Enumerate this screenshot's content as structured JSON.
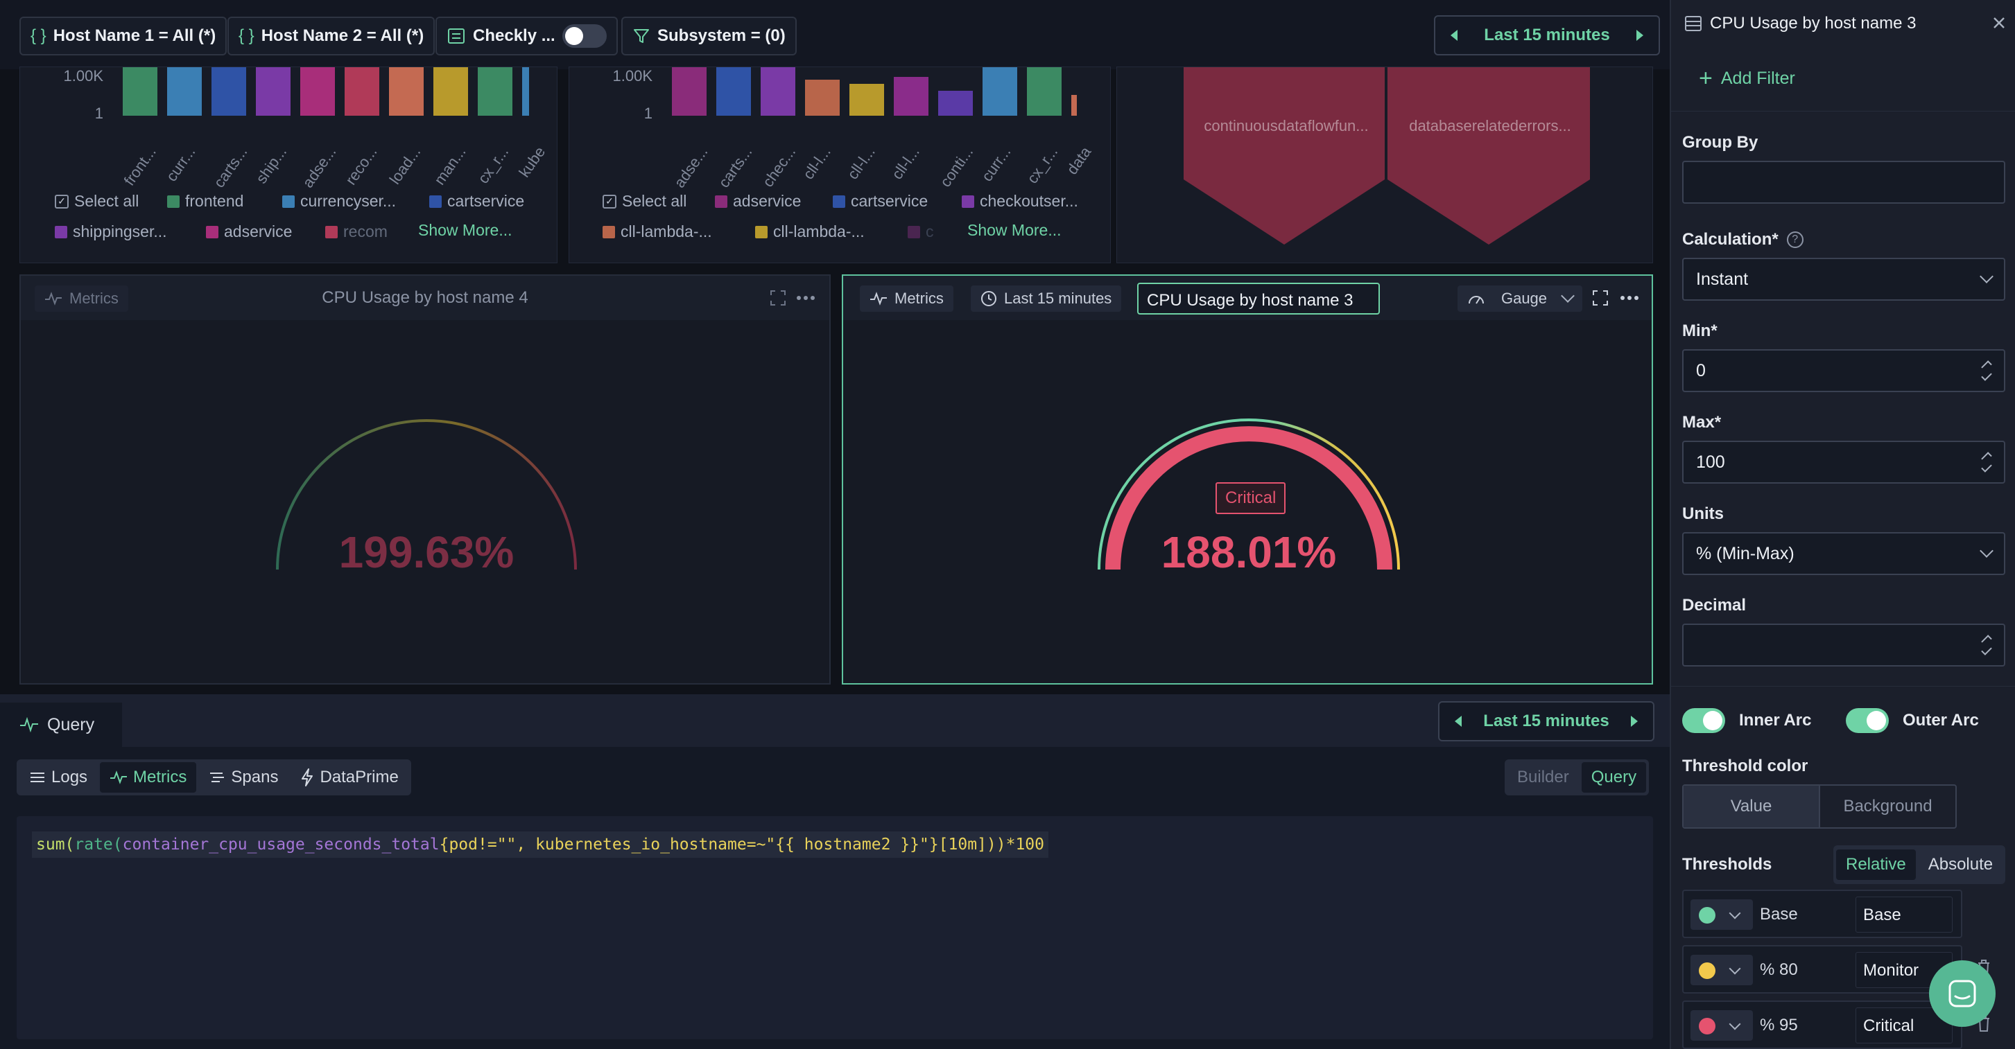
{
  "filters": {
    "host1": "Host Name 1 = All (*)",
    "host2": "Host Name 2 = All (*)",
    "checkly": "Checkly ...",
    "subsystem": "Subsystem = (0)",
    "time": "Last 15 minutes"
  },
  "top_widgets": {
    "left": {
      "yticks": [
        "1.00K",
        "1"
      ],
      "xticks": [
        "front...",
        "curr...",
        "carts...",
        "ship...",
        "adse...",
        "reco...",
        "load...",
        "man...",
        "cx_r...",
        "kube"
      ],
      "legend": [
        "Select all",
        "frontend",
        "currencyser...",
        "cartservice",
        "shippingser...",
        "adservice",
        "recom"
      ],
      "show_more": "Show More..."
    },
    "middle": {
      "yticks": [
        "1.00K",
        "1"
      ],
      "xticks": [
        "adse...",
        "carts...",
        "chec...",
        "cll-l...",
        "cll-l...",
        "cll-l...",
        "conti...",
        "curr...",
        "cx_r...",
        "data"
      ],
      "legend": [
        "Select all",
        "adservice",
        "cartservice",
        "checkoutser...",
        "cll-lambda-...",
        "cll-lambda-...",
        "c"
      ],
      "show_more": "Show More..."
    },
    "right": {
      "labels": [
        "continuousdataflowfun...",
        "databaserelatederrors..."
      ]
    }
  },
  "panel_left": {
    "metrics_label": "Metrics",
    "title": "CPU Usage by host name 4",
    "value": "199.63%"
  },
  "panel_right": {
    "metrics_label": "Metrics",
    "time_label": "Last 15 minutes",
    "title_input": "CPU Usage by host name 3",
    "viz_label": "Gauge",
    "badge": "Critical",
    "value": "188.01%"
  },
  "query": {
    "tab_label": "Query",
    "time": "Last 15 minutes",
    "sources": [
      "Logs",
      "Metrics",
      "Spans",
      "DataPrime"
    ],
    "mode_builder": "Builder",
    "mode_query": "Query",
    "code": {
      "fn1": "sum(",
      "fn2": "rate(",
      "metric": "container_cpu_usage_seconds_total",
      "rest": "{pod!=\"\", kubernetes_io_hostname=~\"{{ hostname2 }}\"}[10m]))*100"
    }
  },
  "side": {
    "title": "CPU Usage by host name 3",
    "add_filter": "Add Filter",
    "group_by_label": "Group By",
    "group_by_value": "",
    "calc_label": "Calculation*",
    "calc_value": "Instant",
    "min_label": "Min*",
    "min_value": "0",
    "max_label": "Max*",
    "max_value": "100",
    "units_label": "Units",
    "units_value": "% (Min-Max)",
    "decimal_label": "Decimal",
    "decimal_value": "",
    "inner_arc": "Inner Arc",
    "outer_arc": "Outer Arc",
    "threshold_color_label": "Threshold color",
    "tc_value": "Value",
    "tc_background": "Background",
    "thresholds_label": "Thresholds",
    "relative": "Relative",
    "absolute": "Absolute",
    "thresholds": [
      {
        "color": "#6fd3a6",
        "value": "Base",
        "name": "Base"
      },
      {
        "color": "#f2c94c",
        "value": "% 80",
        "name": "Monitor"
      },
      {
        "color": "#e5536f",
        "value": "% 95",
        "name": "Critical"
      }
    ]
  },
  "colors": {
    "accent": "#6fd3a6",
    "critical": "#e5536f",
    "warning": "#f2c94c"
  }
}
